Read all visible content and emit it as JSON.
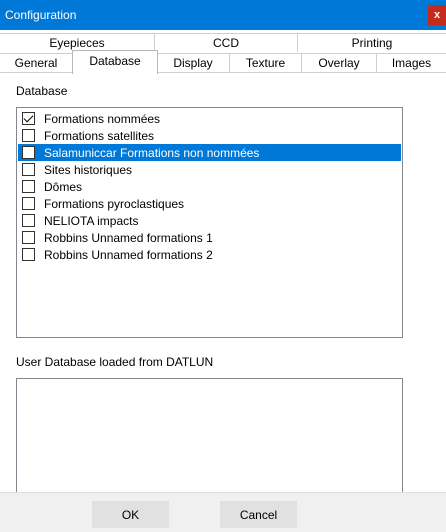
{
  "window": {
    "title": "Configuration",
    "close_glyph": "x"
  },
  "tabs_top": [
    {
      "label": "Eyepieces"
    },
    {
      "label": "CCD"
    },
    {
      "label": "Printing"
    }
  ],
  "tabs_bottom": [
    {
      "label": "General"
    },
    {
      "label": "Database",
      "active": true
    },
    {
      "label": "Display"
    },
    {
      "label": "Texture"
    },
    {
      "label": "Overlay"
    },
    {
      "label": "Images"
    }
  ],
  "database": {
    "section_label": "Database",
    "items": [
      {
        "label": "Formations nommées",
        "checked": true,
        "selected": false
      },
      {
        "label": "Formations satellites",
        "checked": false,
        "selected": false
      },
      {
        "label": "Salamuniccar Formations non nommées",
        "checked": false,
        "selected": true
      },
      {
        "label": "Sites historiques",
        "checked": false,
        "selected": false
      },
      {
        "label": "Dômes",
        "checked": false,
        "selected": false
      },
      {
        "label": "Formations pyroclastiques",
        "checked": false,
        "selected": false
      },
      {
        "label": "NELIOTA impacts",
        "checked": false,
        "selected": false
      },
      {
        "label": "Robbins Unnamed formations 1",
        "checked": false,
        "selected": false
      },
      {
        "label": "Robbins Unnamed formations 2",
        "checked": false,
        "selected": false
      }
    ]
  },
  "user_database": {
    "label": "User Database loaded from DATLUN"
  },
  "buttons": {
    "ok": "OK",
    "cancel": "Cancel"
  },
  "colors": {
    "titlebar": "#0078d7",
    "selection": "#0078d7",
    "close": "#c42b1c"
  }
}
